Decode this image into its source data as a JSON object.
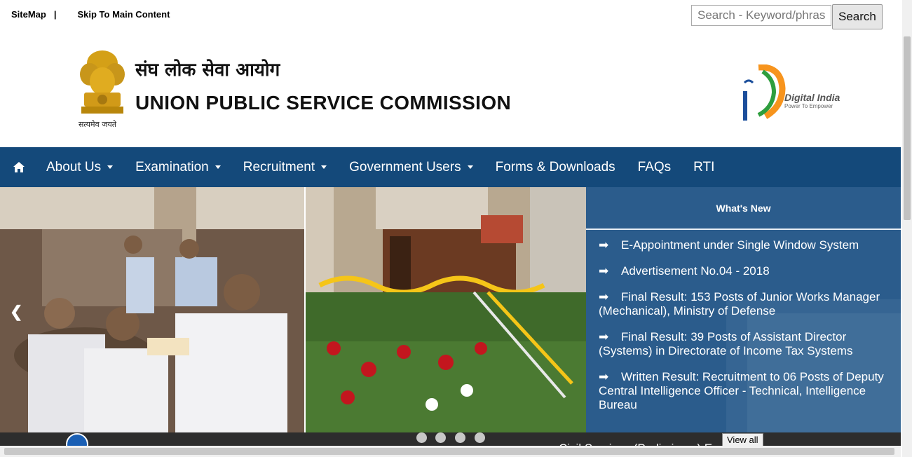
{
  "top_links": {
    "sitemap": "SiteMap",
    "separator": "|",
    "skip": "Skip To Main Content"
  },
  "search": {
    "placeholder": "Search - Keyword/phrase",
    "button_label": "Search"
  },
  "header": {
    "title_hindi": "संघ लोक सेवा आयोग",
    "title_english": "UNION PUBLIC SERVICE COMMISSION",
    "emblem_caption": "सत्यमेव जयते",
    "digital_india": "Digital India",
    "digital_india_tagline": "Power To Empower"
  },
  "nav": {
    "home_icon": "home-icon",
    "items": [
      {
        "label": "About Us",
        "has_dropdown": true
      },
      {
        "label": "Examination",
        "has_dropdown": true
      },
      {
        "label": "Recruitment",
        "has_dropdown": true
      },
      {
        "label": "Government Users",
        "has_dropdown": true
      },
      {
        "label": "Forms & Downloads",
        "has_dropdown": false
      },
      {
        "label": "FAQs",
        "has_dropdown": false
      },
      {
        "label": "RTI",
        "has_dropdown": false
      }
    ]
  },
  "carousel": {
    "prev": "❮",
    "next": "❯",
    "slide_count": 4
  },
  "whats_new": {
    "title": "What's New",
    "items": [
      "E-Appointment under Single Window System",
      "Advertisement No.04 - 2018",
      "Final Result: 153 Posts of Junior Works Manager (Mechanical), Ministry of Defense",
      "Final Result: 39 Posts of Assistant Director (Systems) in Directorate of Income Tax Systems",
      "Written Result: Recruitment to 06 Posts of Deputy Central Intelligence Officer - Technical, Intelligence Bureau"
    ],
    "view_all": "View all",
    "ticker": "Civil Services (Preliminary) E"
  },
  "colors": {
    "nav_bg": "#14497a",
    "news_bg": "#2a5a8a"
  }
}
